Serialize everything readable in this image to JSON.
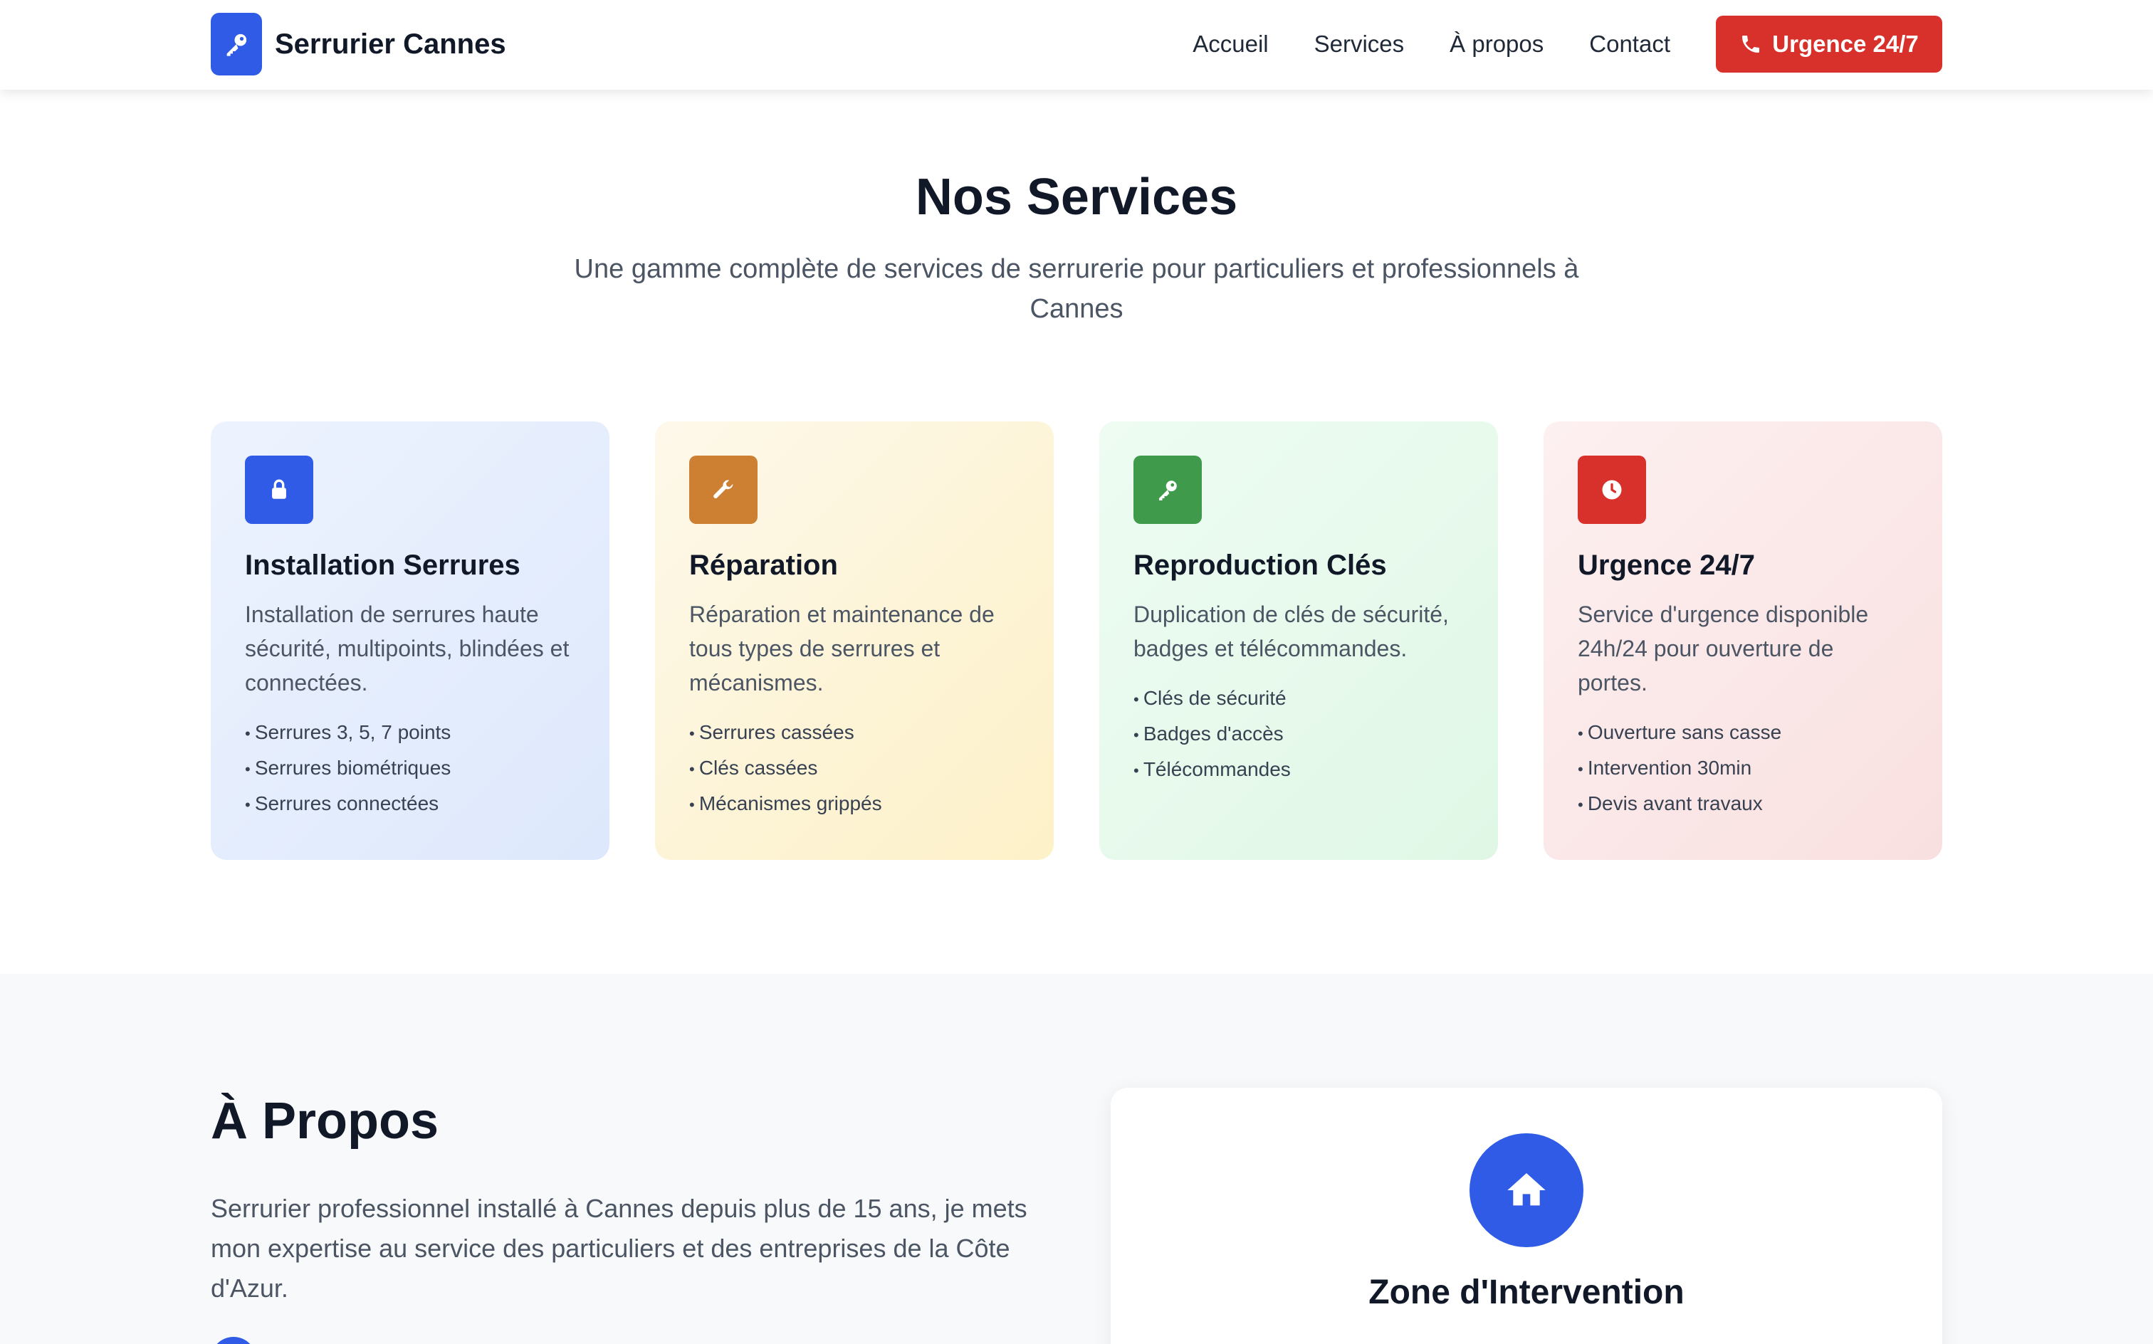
{
  "header": {
    "brand": "Serrurier Cannes",
    "nav": [
      "Accueil",
      "Services",
      "À propos",
      "Contact"
    ],
    "cta_label": "Urgence 24/7"
  },
  "services": {
    "title": "Nos Services",
    "subtitle": "Une gamme complète de services de serrurerie pour particuliers et professionnels à Cannes",
    "cards": [
      {
        "icon": "lock-icon",
        "color": "#2f5be6",
        "title": "Installation Serrures",
        "description": "Installation de serrures haute sécurité, multipoints, blindées et connectées.",
        "items": [
          "Serrures 3, 5, 7 points",
          "Serrures biométriques",
          "Serrures connectées"
        ]
      },
      {
        "icon": "wrench-icon",
        "color": "#cd7f32",
        "title": "Réparation",
        "description": "Réparation et maintenance de tous types de serrures et mécanismes.",
        "items": [
          "Serrures cassées",
          "Clés cassées",
          "Mécanismes grippés"
        ]
      },
      {
        "icon": "key-icon",
        "color": "#3f9b4b",
        "title": "Reproduction Clés",
        "description": "Duplication de clés de sécurité, badges et télécommandes.",
        "items": [
          "Clés de sécurité",
          "Badges d'accès",
          "Télécommandes"
        ]
      },
      {
        "icon": "clock-icon",
        "color": "#d8312b",
        "title": "Urgence 24/7",
        "description": "Service d'urgence disponible 24h/24 pour ouverture de portes.",
        "items": [
          "Ouverture sans casse",
          "Intervention 30min",
          "Devis avant travaux"
        ]
      }
    ]
  },
  "about": {
    "title": "À Propos",
    "text": "Serrurier professionnel installé à Cannes depuis plus de 15 ans, je mets mon expertise au service des particuliers et des entreprises de la Côte d'Azur.",
    "zone_title": "Zone d'Intervention"
  },
  "colors": {
    "primary": "#2f5be6",
    "danger": "#d8312b"
  }
}
